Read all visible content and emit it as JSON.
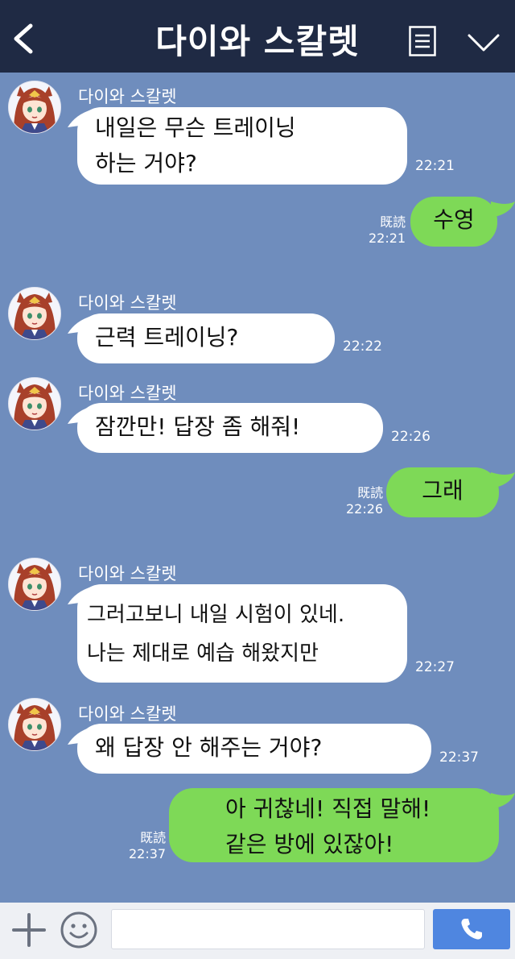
{
  "header": {
    "title": "다이와 스칼렛",
    "back_icon": "chevron-left-icon",
    "menu_icon": "list-icon",
    "fold_icon": "chevron-down-icon"
  },
  "messages": [
    {
      "sender": "다이와 스칼렛",
      "text": "내일은 무슨 트레이닝\n하는 거야?",
      "time": "22:21"
    },
    {
      "text": "수영",
      "read": "既読",
      "time": "22:21"
    },
    {
      "sender": "다이와 스칼렛",
      "text": "근력 트레이닝?",
      "time": "22:22"
    },
    {
      "sender": "다이와 스칼렛",
      "text": "잠깐만! 답장 좀 해줘!",
      "time": "22:26"
    },
    {
      "text": "그래",
      "read": "既読",
      "time": "22:26"
    },
    {
      "sender": "다이와 스칼렛",
      "text": "그러고보니 내일 시험이 있네.\n나는 제대로 예습 해왔지만",
      "time": "22:27"
    },
    {
      "sender": "다이와 스칼렛",
      "text": "왜 답장 안 해주는 거야?",
      "time": "22:37"
    },
    {
      "text": "아 귀찮네! 직접 말해!\n같은 방에 있잖아!",
      "read": "既読",
      "time": "22:37"
    }
  ],
  "footer": {
    "input_placeholder": "",
    "plus_icon": "plus-icon",
    "emoji_icon": "smiley-icon",
    "call_icon": "phone-icon"
  },
  "colors": {
    "background": "#6f8dbd",
    "header": "#1f2a44",
    "my_bubble": "#7ed957",
    "their_bubble": "#ffffff",
    "call_button": "#4f86e0"
  }
}
